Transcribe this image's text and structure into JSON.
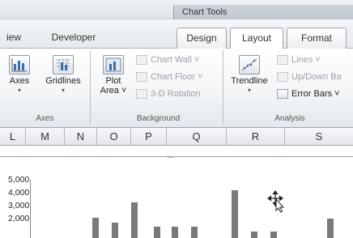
{
  "ribbon": {
    "context_title": "Chart Tools",
    "tabs": [
      {
        "label": "iew"
      },
      {
        "label": "Developer"
      },
      {
        "label": "Design"
      },
      {
        "label": "Layout"
      },
      {
        "label": "Format"
      }
    ],
    "groups": {
      "axes": {
        "label": "Axes",
        "axes_button": "Axes",
        "gridlines_button": "Gridlines"
      },
      "background": {
        "label": "Background",
        "plot_area_button_line1": "Plot",
        "plot_area_button_line2": "Area ˅",
        "chart_wall": "Chart Wall ˅",
        "chart_floor": "Chart Floor ˅",
        "rotation": "3-D Rotation"
      },
      "analysis": {
        "label": "Analysis",
        "trendline_button": "Trendline",
        "lines": "Lines ˅",
        "up_down_bars": "Up/Down Ba",
        "error_bars": "Error Bars ˅"
      }
    }
  },
  "columns": [
    "L",
    "M",
    "N",
    "O",
    "P",
    "Q",
    "R",
    "S"
  ],
  "chart_handle": "····",
  "chart_data": {
    "type": "bar",
    "y_ticks": [
      "5,000",
      "4,000",
      "3,000",
      "2,000"
    ],
    "values": [
      2200,
      1800,
      3400,
      1500,
      1500,
      1500,
      4300,
      1100,
      1100,
      2100
    ],
    "ylim": [
      1000,
      5000
    ]
  }
}
